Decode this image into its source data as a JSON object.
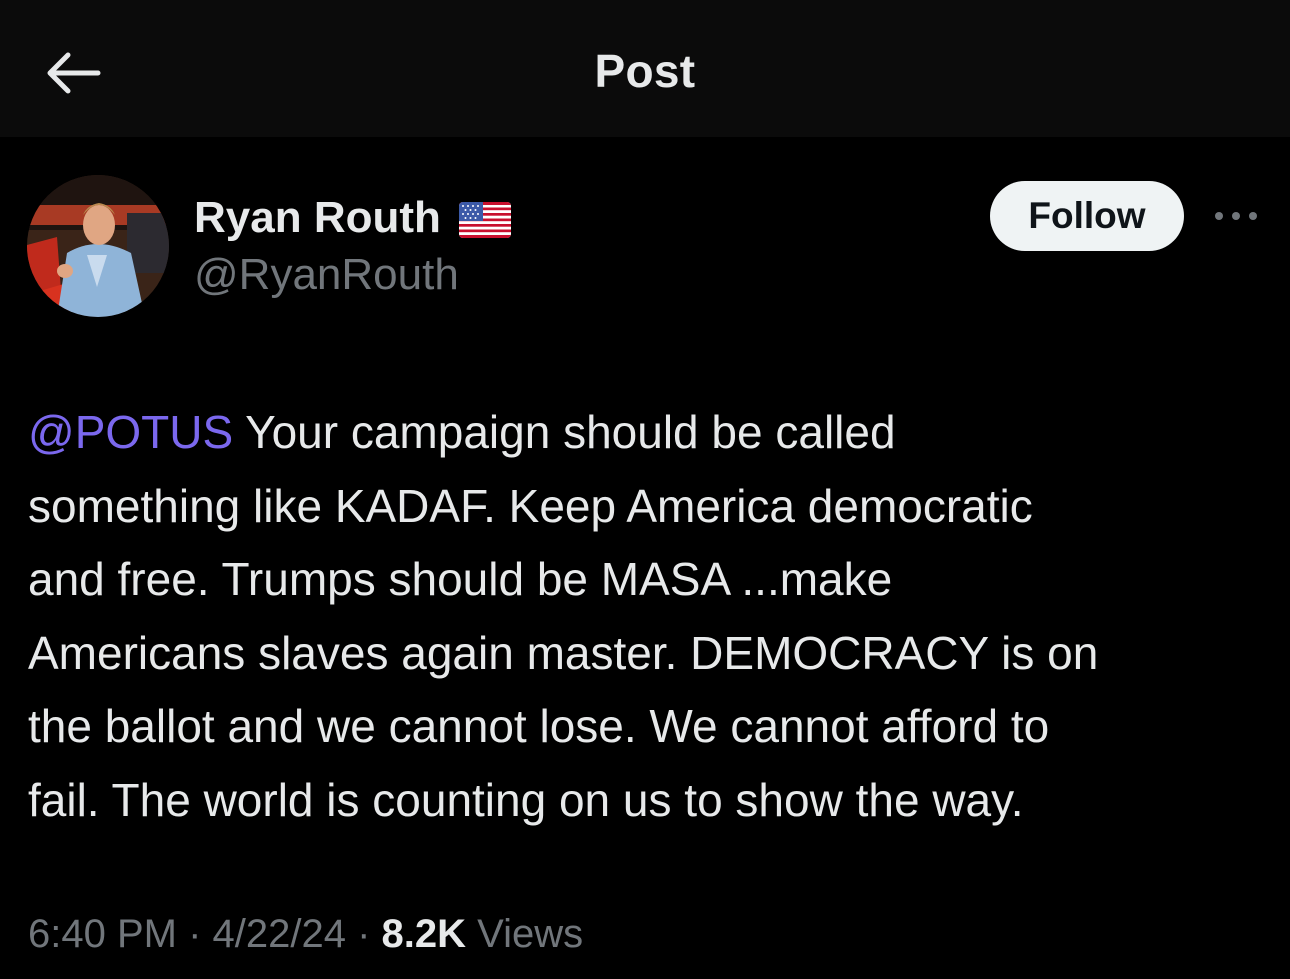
{
  "header": {
    "title": "Post",
    "back_icon": "arrow-left-icon"
  },
  "author": {
    "display_name": "Ryan Routh",
    "flag_icon": "us-flag-icon",
    "handle": "@RyanRouth",
    "avatar_icon": "profile-photo"
  },
  "actions": {
    "follow_label": "Follow",
    "more_icon": "more-horizontal-icon"
  },
  "post": {
    "mention": "@POTUS",
    "lines": [
      " Your campaign should be called",
      "something like KADAF. Keep America democratic",
      "and free. Trumps should be MASA ...make",
      "Americans slaves again master. DEMOCRACY is on",
      "the ballot and we cannot lose. We cannot afford to",
      "fail. The world is counting on us to show the way."
    ]
  },
  "meta": {
    "time": "6:40 PM",
    "separator": " · ",
    "date": "4/22/24",
    "views_count": "8.2K",
    "views_label": " Views"
  },
  "colors": {
    "background": "#000000",
    "header_background": "#0b0b0b",
    "text": "#e7e9ea",
    "muted": "#71767b",
    "mention": "#7b68ee",
    "follow_bg": "#eff3f4"
  }
}
